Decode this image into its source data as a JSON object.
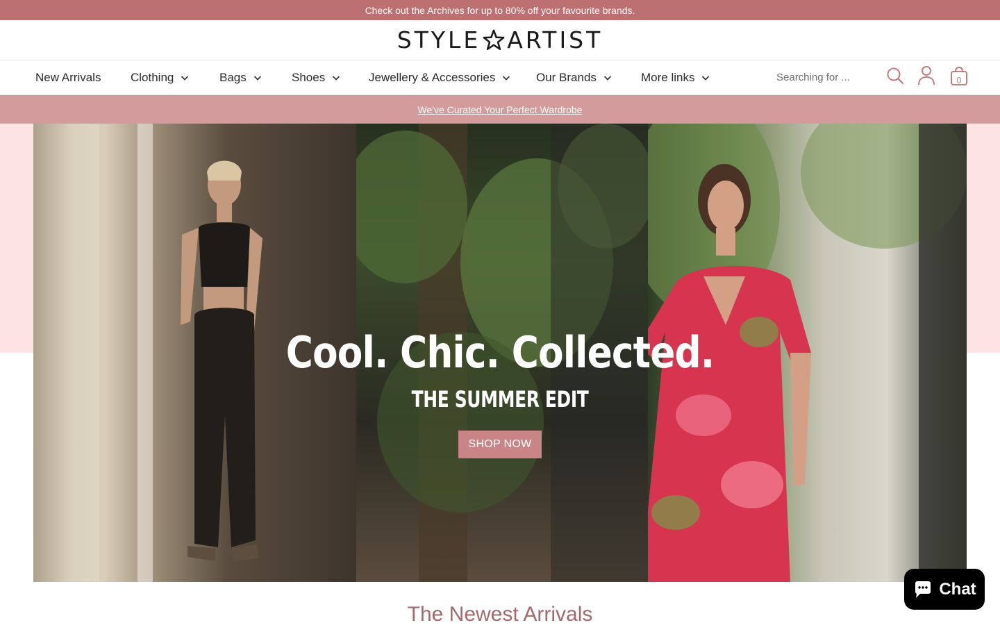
{
  "announcement": {
    "text": "Check out the Archives for up to 80% off your favourite brands."
  },
  "brand": {
    "part1": "STYLE",
    "part2": "ARTIST"
  },
  "nav": {
    "items": [
      {
        "label": "New Arrivals",
        "has_dropdown": false
      },
      {
        "label": "Clothing",
        "has_dropdown": true
      },
      {
        "label": "Bags",
        "has_dropdown": true
      },
      {
        "label": "Shoes",
        "has_dropdown": true
      },
      {
        "label": "Jewellery & Accessories",
        "has_dropdown": true
      },
      {
        "label": "Our Brands",
        "has_dropdown": true
      },
      {
        "label": "More links",
        "has_dropdown": true
      }
    ],
    "search_placeholder": "Searching for ...",
    "cart_count": "0",
    "icons": [
      "search-icon",
      "account-icon",
      "cart-icon",
      "chevron-down-icon"
    ]
  },
  "sub_banner": {
    "link_text": "We've Curated Your Perfect Wardrobe"
  },
  "hero": {
    "title": "Cool. Chic. Collected.",
    "subtitle": "THE SUMMER EDIT",
    "cta": "SHOP NOW"
  },
  "section": {
    "title": "The Newest Arrivals"
  },
  "chat": {
    "label": "Chat"
  },
  "colors": {
    "announcement_bg": "#bd7071",
    "sub_banner_bg": "#d39b9c",
    "pink_band": "#fde3e4",
    "accent": "#c98586",
    "section_title": "#a5696b"
  }
}
